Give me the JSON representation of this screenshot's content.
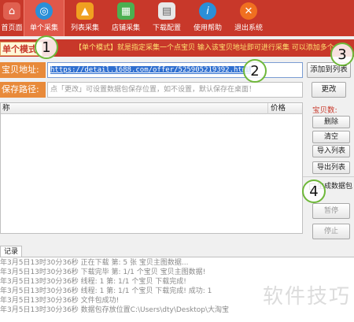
{
  "toolbar": {
    "items": [
      {
        "label": "首页面",
        "icon": "home-icon",
        "color": "#c8382a"
      },
      {
        "label": "单个采集",
        "icon": "single-collect-icon",
        "color": "#2a8fd8",
        "active": true
      },
      {
        "label": "列表采集",
        "icon": "list-collect-icon",
        "color": "#f0a020"
      },
      {
        "label": "店铺采集",
        "icon": "shop-collect-icon",
        "color": "#4caf50"
      },
      {
        "label": "下载配置",
        "icon": "download-config-icon",
        "color": "#d0d0d0"
      },
      {
        "label": "使用帮助",
        "icon": "help-icon",
        "color": "#2a8fd8"
      },
      {
        "label": "退出系统",
        "icon": "exit-icon",
        "color": "#f07020"
      }
    ]
  },
  "mode": {
    "tab_label": "单个模式",
    "info": "【单个模式】就是指定采集一个点宝贝   输入该宝贝地址即可进行采集   可以添加多个"
  },
  "address": {
    "label": "宝贝地址:",
    "value": "https://detail.1688.com/offer/525905219392.html",
    "add_button": "添加到列表"
  },
  "save_path": {
    "label": "保存路径:",
    "placeholder": "点「更改」可设置数据包保存位置，如不设置，默认保存在桌面！",
    "change_button": "更改"
  },
  "list": {
    "col_name": "称",
    "col_price": "价格"
  },
  "right_panel": {
    "count_label": "宝贝数:",
    "delete": "删除",
    "clear": "清空",
    "import": "导入列表",
    "export": "导出列表",
    "generate": "生成数据包",
    "pause": "暂停",
    "stop": "停止"
  },
  "log": {
    "tab_label": "记录",
    "lines": [
      "年3月5日13时30分36秒   正在下载 第: 5  张 宝贝主图数据...",
      "年3月5日13时30分36秒   下载完毕 第: 1/1  个宝贝   宝贝主图数据!",
      "年3月5日13时30分36秒   线程: 1 第: 1/1  个宝贝 下载完成!",
      "年3月5日13时30分36秒   线程: 1 第: 1/1  个宝贝 下载完成! 成功: 1",
      "年3月5日13时30分36秒   文件包成功!",
      "年3月5日13时30分36秒   数据包存放位置C:\\Users\\dty\\Desktop\\大淘宝"
    ]
  },
  "watermark": "软件技巧",
  "callouts": [
    "1",
    "2",
    "3",
    "4"
  ]
}
